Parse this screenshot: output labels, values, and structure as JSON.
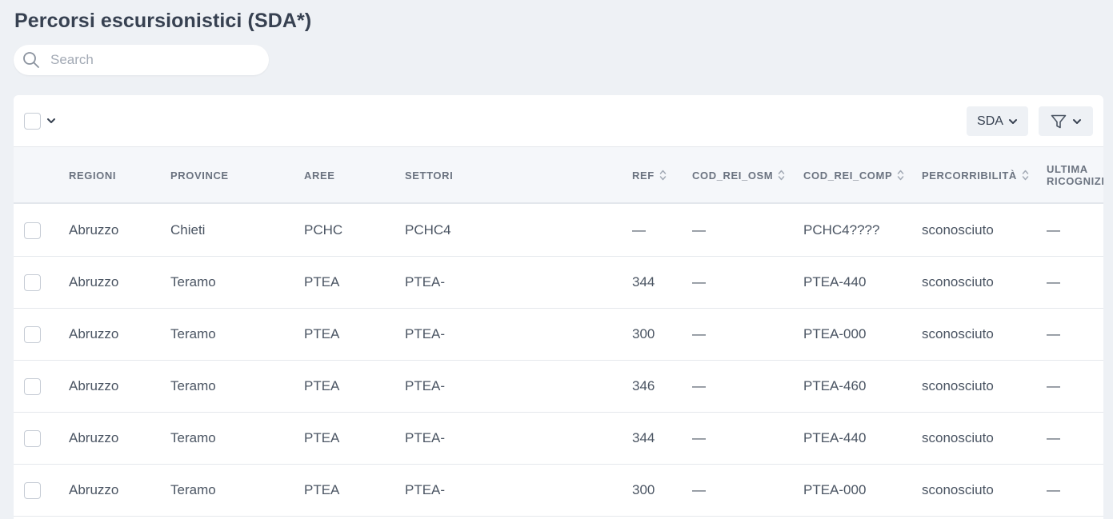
{
  "page": {
    "title": "Percorsi escursionistici (SDA*)"
  },
  "search": {
    "placeholder": "Search",
    "value": ""
  },
  "toolbar": {
    "lens_label": "SDA"
  },
  "columns": [
    {
      "key": "regioni",
      "label": "REGIONI",
      "sortable": false
    },
    {
      "key": "province",
      "label": "PROVINCE",
      "sortable": false
    },
    {
      "key": "aree",
      "label": "AREE",
      "sortable": false
    },
    {
      "key": "settori",
      "label": "SETTORI",
      "sortable": false
    },
    {
      "key": "ref",
      "label": "REF",
      "sortable": true
    },
    {
      "key": "cod_rei_osm",
      "label": "COD_REI_OSM",
      "sortable": true
    },
    {
      "key": "cod_rei_comp",
      "label": "COD_REI_COMP",
      "sortable": true
    },
    {
      "key": "percorribilita",
      "label": "PERCORRIBILITÀ",
      "sortable": true
    },
    {
      "key": "ultima_ricognizione",
      "label": "ULTIMA RICOGNIZI",
      "sortable": false
    }
  ],
  "rows": [
    {
      "regioni": "Abruzzo",
      "province": "Chieti",
      "aree": "PCHC",
      "settori": "PCHC4",
      "ref": "—",
      "cod_rei_osm": "—",
      "cod_rei_comp": "PCHC4????",
      "percorribilita": "sconosciuto",
      "ultima_ricognizione": "—"
    },
    {
      "regioni": "Abruzzo",
      "province": "Teramo",
      "aree": "PTEA",
      "settori": "PTEA-",
      "ref": "344",
      "cod_rei_osm": "—",
      "cod_rei_comp": "PTEA-440",
      "percorribilita": "sconosciuto",
      "ultima_ricognizione": "—"
    },
    {
      "regioni": "Abruzzo",
      "province": "Teramo",
      "aree": "PTEA",
      "settori": "PTEA-",
      "ref": "300",
      "cod_rei_osm": "—",
      "cod_rei_comp": "PTEA-000",
      "percorribilita": "sconosciuto",
      "ultima_ricognizione": "—"
    },
    {
      "regioni": "Abruzzo",
      "province": "Teramo",
      "aree": "PTEA",
      "settori": "PTEA-",
      "ref": "346",
      "cod_rei_osm": "—",
      "cod_rei_comp": "PTEA-460",
      "percorribilita": "sconosciuto",
      "ultima_ricognizione": "—"
    },
    {
      "regioni": "Abruzzo",
      "province": "Teramo",
      "aree": "PTEA",
      "settori": "PTEA-",
      "ref": "344",
      "cod_rei_osm": "—",
      "cod_rei_comp": "PTEA-440",
      "percorribilita": "sconosciuto",
      "ultima_ricognizione": "—"
    },
    {
      "regioni": "Abruzzo",
      "province": "Teramo",
      "aree": "PTEA",
      "settori": "PTEA-",
      "ref": "300",
      "cod_rei_osm": "—",
      "cod_rei_comp": "PTEA-000",
      "percorribilita": "sconosciuto",
      "ultima_ricognizione": "—"
    }
  ],
  "colors": {
    "background": "#eef1f5",
    "card": "#ffffff",
    "header_bg": "#f5f7fa",
    "text": "#374151",
    "muted": "#6b7380",
    "border": "#e5e8ec"
  },
  "icons": {
    "search": "search-icon",
    "select_caret": "chevron-down-icon",
    "filter": "filter-funnel-icon",
    "sort": "sort-arrows-icon"
  }
}
